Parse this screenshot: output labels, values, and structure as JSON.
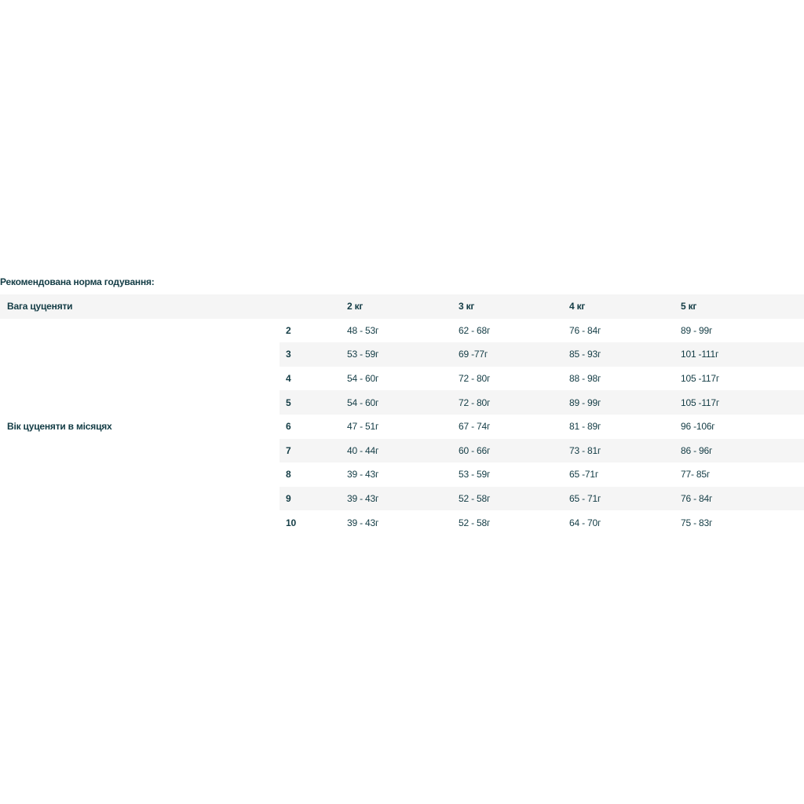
{
  "caption": "Рекомендована норма годування:",
  "table": {
    "weight_label": "Вага цуценяти",
    "age_label": "Вік цуценяти в місяцях",
    "weights": [
      "2 кг",
      "3 кг",
      "4 кг",
      "5 кг"
    ],
    "rows": [
      {
        "age": "2",
        "values": [
          "48 - 53г",
          "62 - 68г",
          "76 - 84г",
          "89 - 99г"
        ]
      },
      {
        "age": "3",
        "values": [
          "53 - 59г",
          "69 -77г",
          "85 - 93г",
          "101 -111г"
        ]
      },
      {
        "age": "4",
        "values": [
          "54 - 60г",
          "72 - 80г",
          "88 - 98г",
          "105 -117г"
        ]
      },
      {
        "age": "5",
        "values": [
          "54 - 60г",
          "72 - 80г",
          "89 - 99г",
          "105 -117г"
        ]
      },
      {
        "age": "6",
        "values": [
          "47 - 51г",
          "67 - 74г",
          "81 - 89г",
          "96 -106г"
        ]
      },
      {
        "age": "7",
        "values": [
          "40 - 44г",
          "60 - 66г",
          "73 - 81г",
          "86 - 96г"
        ]
      },
      {
        "age": "8",
        "values": [
          "39 - 43г",
          "53 - 59г",
          "65 -71г",
          "77- 85г"
        ]
      },
      {
        "age": "9",
        "values": [
          "39 - 43г",
          "52 - 58г",
          "65 - 71г",
          "76 - 84г"
        ]
      },
      {
        "age": "10",
        "values": [
          "39 - 43г",
          "52 - 58г",
          "64 - 70г",
          "75 - 83г"
        ]
      }
    ]
  },
  "colors": {
    "text": "#133c45",
    "row_shade": "#f5f5f5",
    "background": "#ffffff"
  }
}
